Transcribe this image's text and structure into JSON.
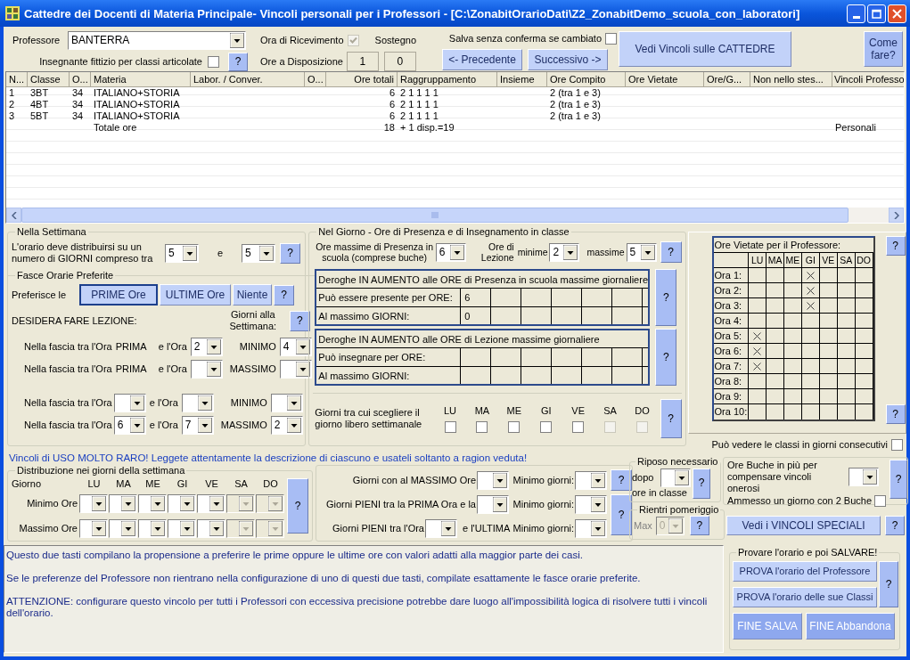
{
  "window": {
    "title": "Cattedre dei Docenti di Materia Principale- Vincoli personali per i Professori  -  [C:\\ZonabitOrarioDati\\Z2_ZonabitDemo_scuola_con_laboratori]"
  },
  "header": {
    "professor": {
      "label": "Professore",
      "value": "BANTERRA"
    },
    "fictitious": {
      "label": "Insegnante fittizio per classi articolate",
      "checked": false,
      "help": "?"
    },
    "reception": {
      "label": "Ora di Ricevimento",
      "checked": true,
      "disabled": true
    },
    "support": {
      "label": "Sostegno",
      "value": "0"
    },
    "available": {
      "label": "Ore a Disposizione",
      "value": "1"
    },
    "autosave": {
      "label": "Salva senza conferma se cambiato",
      "checked": false
    },
    "prev_button": "<- Precedente",
    "next_button": "Successivo ->",
    "constraints_button": "Vedi Vincoli sulle CATTEDRE",
    "howto_button": "Come fare?"
  },
  "table": {
    "columns": [
      "N...",
      "Classe",
      "O...",
      "Materia",
      "Labor. / Conver.",
      "O...",
      "Ore totali",
      "Raggruppamento",
      "Insieme",
      "Ore Compito",
      "Ore Vietate",
      "Ore/G...",
      "Non nello stes...",
      "Vincoli Professo"
    ],
    "rows": [
      [
        "1",
        "3BT",
        "34",
        "ITALIANO+STORIA",
        null,
        null,
        "6",
        "2 1 1 1 1",
        null,
        "2 (tra 1 e 3)",
        null,
        null,
        null,
        null
      ],
      [
        "2",
        "4BT",
        "34",
        "ITALIANO+STORIA",
        null,
        null,
        "6",
        "2 1 1 1 1",
        null,
        "2 (tra 1 e 3)",
        null,
        null,
        null,
        null
      ],
      [
        "3",
        "5BT",
        "34",
        "ITALIANO+STORIA",
        null,
        null,
        "6",
        "2 1 1 1 1",
        null,
        "2 (tra 1 e 3)",
        null,
        null,
        null,
        null
      ],
      [
        null,
        null,
        null,
        "Totale ore",
        null,
        null,
        "18",
        "+ 1 disp.=19",
        null,
        null,
        null,
        null,
        null,
        "Personali"
      ]
    ]
  },
  "week": {
    "title": "Nella Settimana",
    "days_text": "L'orario deve distribuirsi su un numero di GIORNI compreso tra",
    "days_min": "5",
    "and": "e",
    "days_max": "5",
    "help": "?",
    "preferred": {
      "title": "Fasce Orarie Preferite",
      "label": "Preferisce le",
      "help": "?",
      "options": [
        {
          "label": "PRIME Ore",
          "selected": true
        },
        {
          "label": "ULTIME Ore",
          "selected": false
        },
        {
          "label": "Niente",
          "selected": false
        }
      ]
    },
    "wish_label": "DESIDERA FARE LEZIONE:",
    "days_per_week_label": "Giorni alla Settimana:",
    "days_help": "?",
    "bands": [
      {
        "kind": "fixed",
        "label": "Nella fascia tra l'Ora",
        "from": "PRIMA",
        "to_label": "e l'Ora",
        "to": "2",
        "limit_label": "MINIMO",
        "limit": "4"
      },
      {
        "kind": "fixed",
        "label": "Nella fascia tra l'Ora",
        "from": "PRIMA",
        "to_label": "e l'Ora",
        "limit_label": "MASSIMO"
      },
      {
        "kind": "select",
        "label": "Nella fascia tra l'Ora",
        "to_label": "e l'Ora",
        "limit_label": "MINIMO"
      },
      {
        "kind": "select",
        "label": "Nella fascia tra l'Ora",
        "from": "6",
        "to_label": "e l'Ora",
        "to": "7",
        "limit_label": "MASSIMO",
        "limit": "2"
      }
    ]
  },
  "day": {
    "title": "Nel Giorno - Ore di Presenza e di Insegnamento in classe",
    "presence_label": "Ore massime di Presenza in scuola (comprese buche)",
    "presence": "6",
    "lesson_label": "Ore di Lezione",
    "min_label": "minime",
    "min": "2",
    "max_label": "massime",
    "max": "5",
    "help": "?",
    "exceptions": [
      {
        "title": "Deroghe IN AUMENTO alle ORE di Presenza in scuola massime giornaliere",
        "help": "?",
        "rows": [
          {
            "label": "Può essere presente per ORE:",
            "values": [
              "6"
            ]
          },
          {
            "label": "Al massimo GIORNI:",
            "values": [
              "0"
            ]
          }
        ]
      },
      {
        "title": "Deroghe IN AUMENTO alle ORE di Lezione massime giornaliere",
        "help": "?",
        "rows": [
          {
            "label": "Può insegnare per ORE:"
          },
          {
            "label": "Al massimo GIORNI:"
          }
        ]
      }
    ],
    "free_day": {
      "label": "Giorni tra cui scegliere il giorno libero settimanale",
      "help": "?",
      "days": [
        {
          "label": "LU",
          "checked": false,
          "disabled": false
        },
        {
          "label": "MA",
          "checked": false,
          "disabled": false
        },
        {
          "label": "ME",
          "checked": false,
          "disabled": false
        },
        {
          "label": "GI",
          "checked": false,
          "disabled": false
        },
        {
          "label": "VE",
          "checked": false,
          "disabled": false
        },
        {
          "label": "SA",
          "checked": false,
          "disabled": true
        },
        {
          "label": "DO",
          "checked": false,
          "disabled": true
        }
      ]
    }
  },
  "forbidden": {
    "title": "Ore Vietate per il Professore:",
    "days": [
      "LU",
      "MA",
      "ME",
      "GI",
      "VE",
      "SA",
      "DO"
    ],
    "help_top": "?",
    "help_bottom": "?",
    "hours": [
      {
        "label": "Ora 1:",
        "blocked": [
          false,
          false,
          false,
          true,
          false,
          false,
          false
        ]
      },
      {
        "label": "Ora 2:",
        "blocked": [
          false,
          false,
          false,
          true,
          false,
          false,
          false
        ]
      },
      {
        "label": "Ora 3:",
        "blocked": [
          false,
          false,
          false,
          true,
          false,
          false,
          false
        ]
      },
      {
        "label": "Ora 4:",
        "blocked": [
          false,
          false,
          false,
          false,
          false,
          false,
          false
        ]
      },
      {
        "label": "Ora 5:",
        "blocked": [
          true,
          false,
          false,
          false,
          false,
          false,
          false
        ]
      },
      {
        "label": "Ora 6:",
        "blocked": [
          true,
          false,
          false,
          false,
          false,
          false,
          false
        ]
      },
      {
        "label": "Ora 7:",
        "blocked": [
          true,
          false,
          false,
          false,
          false,
          false,
          false
        ]
      },
      {
        "label": "Ora 8:",
        "blocked": [
          false,
          false,
          false,
          false,
          false,
          false,
          false
        ]
      },
      {
        "label": "Ora 9:",
        "blocked": [
          false,
          false,
          false,
          false,
          false,
          false,
          false
        ]
      },
      {
        "label": "Ora 10:",
        "blocked": [
          false,
          false,
          false,
          false,
          false,
          false,
          false
        ]
      }
    ],
    "consecutive": {
      "label": "Può vedere le classi in giorni consecutivi",
      "checked": false
    }
  },
  "rare": {
    "warning": "Vincoli di USO MOLTO RARO! Leggete attentamente la descrizione di ciascuno e usateli soltanto a ragion veduta!",
    "distribution": {
      "title": "Distribuzione nei giorni della settimana",
      "day_header": "Giorno",
      "help": "?",
      "days": [
        {
          "label": "LU",
          "disabled": false
        },
        {
          "label": "MA",
          "disabled": false
        },
        {
          "label": "ME",
          "disabled": false
        },
        {
          "label": "GI",
          "disabled": false
        },
        {
          "label": "VE",
          "disabled": false
        },
        {
          "label": "SA",
          "disabled": true
        },
        {
          "label": "DO",
          "disabled": true
        }
      ],
      "rows": [
        {
          "label": "Minimo Ore"
        },
        {
          "label": "Massimo Ore"
        }
      ]
    },
    "full_days": {
      "help_top": "?",
      "help_bottom": "?",
      "rows": [
        {
          "label": "Giorni con al MASSIMO Ore",
          "min_label": "Minimo giorni:"
        },
        {
          "label": "Giorni PIENI tra la PRIMA Ora e la",
          "min_label": "Minimo giorni:"
        },
        {
          "label": "Giorni PIENI tra l'Ora",
          "suffix": "e l'ULTIMA",
          "min_label": "Minimo giorni:"
        }
      ]
    },
    "rest": {
      "title": "Riposo necessario",
      "before": "dopo",
      "after": "ore in classe",
      "help": "?"
    },
    "afternoon": {
      "title": "Rientri pomeriggio",
      "label": "Max",
      "value": "0",
      "disabled": true,
      "help": "?"
    },
    "gaps": {
      "label": "Ore Buche in più per compensare vincoli onerosi",
      "help": "?",
      "two_gaps": {
        "label": "Ammesso un giorno con 2 Buche",
        "checked": false
      }
    },
    "special": {
      "button": "Vedi i VINCOLI SPECIALI",
      "help": "?"
    }
  },
  "description": [
    "Questo due tasti compilano la propensione a preferire le prime oppure le ultime ore con valori adatti alla maggior parte dei casi.",
    "Se le preferenze del Professore non rientrano nella configurazione di uno di questi due tasti, compilate esattamente le fasce orarie preferite.",
    "ATTENZIONE: configurare questo vincolo per tutti i Professori con eccessiva precisione potrebbe dare luogo all'impossibilità logica di risolvere tutti i vincoli dell'orario."
  ],
  "test": {
    "title": "Provare  l'orario e poi SALVARE!",
    "buttons": [
      "PROVA l'orario del Professore",
      "PROVA l'orario delle sue Classi"
    ],
    "help": "?",
    "save": "FINE SALVA",
    "abandon": "FINE Abbandona"
  }
}
